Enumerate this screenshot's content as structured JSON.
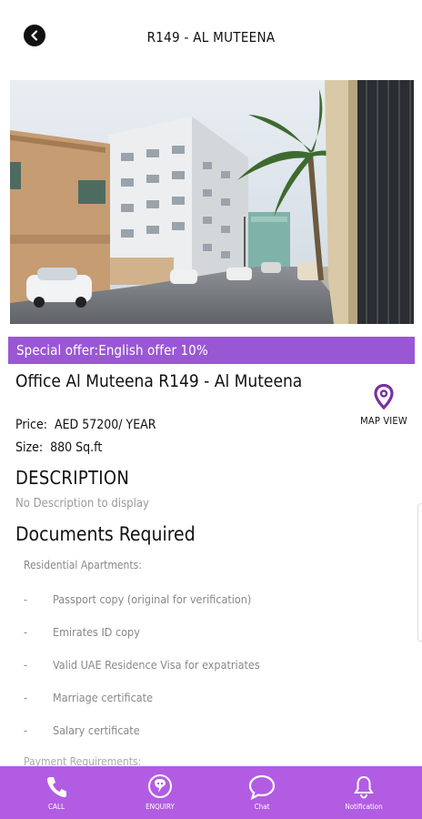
{
  "header": {
    "title": "R149 - AL MUTEENA"
  },
  "offer": {
    "text": "Special offer:English offer 10%"
  },
  "property": {
    "title": "Office Al Muteena R149 - Al Muteena",
    "price_label": "Price:",
    "price_value": "AED 57200/ YEAR",
    "size_label": "Size:",
    "size_value": "880 Sq.ft",
    "map_view_label": "MAP VIEW"
  },
  "description": {
    "heading": "DESCRIPTION",
    "text": "No Description to display"
  },
  "documents": {
    "heading": "Documents Required",
    "subheading": "Residential Apartments:",
    "items": [
      "Passport copy (original for verification)",
      "Emirates ID copy",
      "Valid UAE Residence Visa for expatriates",
      "Marriage certificate",
      "Salary certificate"
    ],
    "partial_next": "Payment Requirements:"
  },
  "nav": {
    "call": "CALL",
    "enquiry": "ENQUIRY",
    "chat": "Chat",
    "notification": "Notification"
  },
  "colors": {
    "offer_bar": "#9a57d3",
    "bottom_nav": "#b25ce3",
    "map_pin": "#7b2fa8"
  }
}
